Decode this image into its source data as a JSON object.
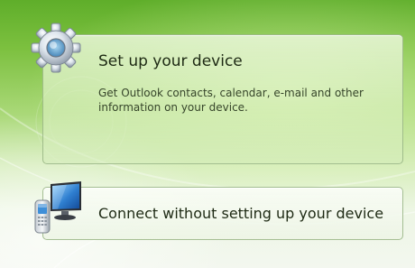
{
  "setup_option": {
    "title": "Set up your device",
    "description": "Get Outlook contacts, calendar, e-mail and other information on your device.",
    "icon": "gear-icon"
  },
  "connect_option": {
    "title": "Connect without setting up your device",
    "icon": "device-connect-icon"
  },
  "colors": {
    "background_top": "#5fae2a",
    "background_bottom": "#f3f7ef",
    "text": "#1e2a14"
  }
}
